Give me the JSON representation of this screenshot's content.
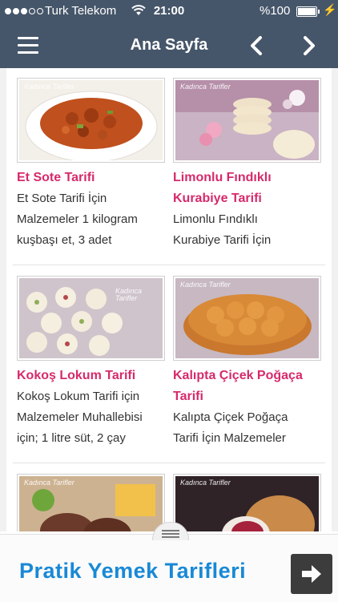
{
  "status_bar": {
    "carrier": "Turk Telekom",
    "time": "21:00",
    "battery": "%100"
  },
  "header": {
    "title": "Ana Sayfa",
    "prev_icon": "chevron-left-icon",
    "next_icon": "chevron-right-icon",
    "menu_icon": "hamburger-menu-icon"
  },
  "recipes": [
    {
      "title": "Et Sote Tarifi",
      "excerpt": [
        "Et Sote Tarifi İçin",
        "Malzemeler 1 kilogram",
        "kuşbaşı et, 3 adet"
      ],
      "logo": "Kadınca Tarifler"
    },
    {
      "title_lines": [
        "Limonlu Fındıklı",
        "Kurabiye Tarifi"
      ],
      "excerpt": [
        "Limonlu Fındıklı",
        "Kurabiye Tarifi İçin"
      ],
      "logo": "Kadınca Tarifler"
    },
    {
      "title": "Kokoş Lokum Tarifi",
      "excerpt": [
        "Kokoş Lokum Tarifi için",
        "Malzemeler Muhallebisi",
        "için; 1 litre süt, 2 çay"
      ],
      "logo": "Kadınca Tarifler"
    },
    {
      "title_lines": [
        "Kalıpta Çiçek Poğaça",
        "Tarifi"
      ],
      "excerpt": [
        "Kalıpta Çiçek Poğaça",
        "Tarifi İçin Malzemeler"
      ],
      "logo": "Kadınca Tarifler"
    },
    {
      "logo": "Kadınca Tarifler"
    },
    {
      "logo": "Kadınca Tarifler"
    }
  ],
  "banner": {
    "text": "Pratik Yemek Tarifleri",
    "button_icon": "arrow-right-icon",
    "handle_icon": "drag-handle-icon"
  },
  "colors": {
    "nav_bg": "#46566a",
    "title_pink": "#d62a6b",
    "banner_blue": "#1989d6"
  }
}
